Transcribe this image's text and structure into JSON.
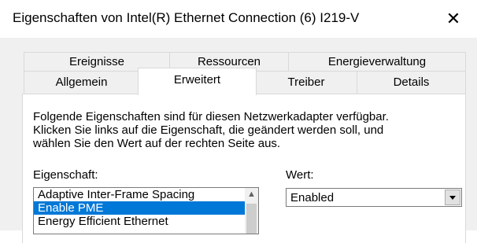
{
  "window": {
    "title": "Eigenschaften von Intel(R) Ethernet Connection (6) I219-V",
    "close_symbol": "✕"
  },
  "tabs": {
    "row1": [
      "Ereignisse",
      "Ressourcen",
      "Energieverwaltung"
    ],
    "row2": [
      "Allgemein",
      "Erweitert",
      "Treiber",
      "Details"
    ],
    "active": "Erweitert"
  },
  "description": [
    "Folgende Eigenschaften sind für diesen Netzwerkadapter verfügbar.",
    "Klicken Sie links auf die Eigenschaft, die geändert werden soll, und",
    "wählen Sie den Wert auf der rechten Seite aus."
  ],
  "property": {
    "label": "Eigenschaft:",
    "items": [
      "Adaptive Inter-Frame Spacing",
      "Enable PME",
      "Energy Efficient Ethernet"
    ],
    "selected": "Enable PME",
    "scroll_up_symbol": "▲"
  },
  "value": {
    "label": "Wert:",
    "selected": "Enabled"
  }
}
